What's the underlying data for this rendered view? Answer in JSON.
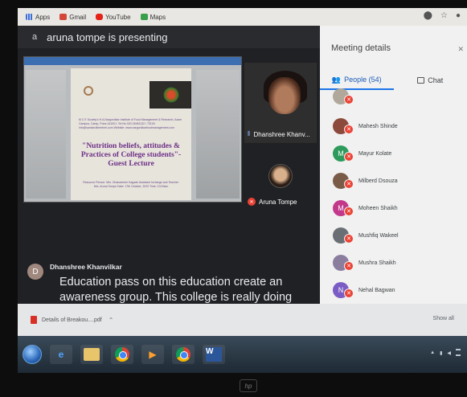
{
  "bookmarks": {
    "items": [
      {
        "label": "Apps",
        "icon": "apps-icon"
      },
      {
        "label": "Gmail",
        "icon": "gmail-icon"
      },
      {
        "label": "YouTube",
        "icon": "youtube-icon"
      },
      {
        "label": "Maps",
        "icon": "maps-icon"
      }
    ]
  },
  "meet": {
    "presenting_letter": "a",
    "presenting_text": "aruna tompe is presenting",
    "slide": {
      "small_text": "M C E Society's H.A.Nargundkar Institute of Food Management & Research, Azam Campus, Camp, Pune-411001. Tel No 020-26451132 / 73100 info@sanskrutibrerbmi.com Website: www.nargundkarfoodmanagement.com",
      "title": "\"Nutrition beliefs, attitudes & Practices of College students\"- Guest Lecture",
      "footer": "Resource Person: Mrs. Dhanashree Kagade Assistant Incharge and Teacher: Mrs. Aruna Tompe Date: 17th October, 2020 Time: 10:00am"
    },
    "tiles": [
      {
        "name": "Dhanshree Khanv..."
      },
      {
        "name": "Aruna Tompe"
      }
    ],
    "caption": {
      "avatar_letter": "D",
      "speaker": "Dhanshree Khanvilkar",
      "text": "Education pass on this education create an awareness group. This college is really doing"
    }
  },
  "panel": {
    "title": "Meeting details",
    "tab_people": "People (54)",
    "tab_chat": "Chat",
    "people": [
      {
        "name": "Mahesh Shinde",
        "avatar": "",
        "color": "#8b4a3c"
      },
      {
        "name": "Mayur Kolate",
        "avatar": "M",
        "color": "#2e9a5c"
      },
      {
        "name": "Milberd Dsouza",
        "avatar": "",
        "color": "#7a5b48"
      },
      {
        "name": "Moheen Shaikh",
        "avatar": "M",
        "color": "#c2388a"
      },
      {
        "name": "Mushfiq Wakeel",
        "avatar": "",
        "color": "#6a6f75"
      },
      {
        "name": "Mushra Shaikh",
        "avatar": "",
        "color": "#8a7d9e"
      },
      {
        "name": "Nehal Bagwan",
        "avatar": "N",
        "color": "#7b5cc4"
      }
    ]
  },
  "downloads": {
    "file": "Details of Breakou....pdf",
    "show_all": "Show all"
  },
  "colors": {
    "meet_bg": "#202124",
    "panel_bg": "#f1f1f1",
    "accent": "#1a73e8",
    "mic_off": "#ea4335"
  }
}
